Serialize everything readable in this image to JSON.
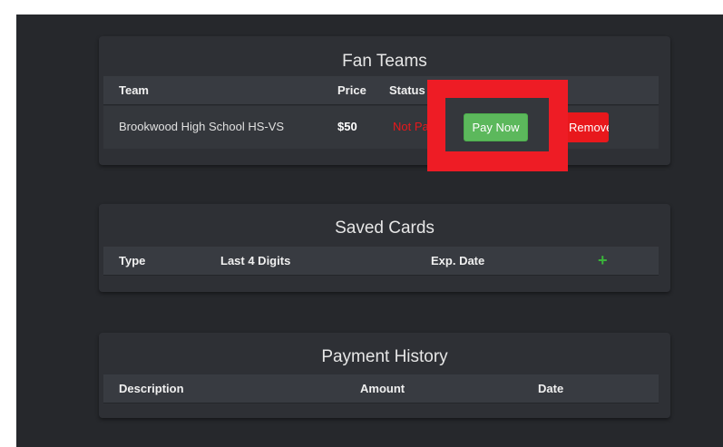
{
  "fan_teams": {
    "title": "Fan Teams",
    "columns": [
      "Team",
      "Price",
      "Status"
    ],
    "row": {
      "team": "Brookwood High School HS-VS",
      "price": "$50",
      "status": "Not Paid",
      "pay_label": "Pay Now",
      "remove_label": "Remove"
    }
  },
  "saved_cards": {
    "title": "Saved Cards",
    "columns": [
      "Type",
      "Last 4 Digits",
      "Exp. Date"
    ],
    "add_icon": "+"
  },
  "payment_history": {
    "title": "Payment History",
    "columns": [
      "Description",
      "Amount",
      "Date"
    ]
  },
  "colors": {
    "background": "#26282c",
    "panel": "#2e3035",
    "status_unpaid": "#e8181c",
    "pay_button": "#5cb85c",
    "highlight": "#ee1c25",
    "add_icon": "#3ab53a"
  }
}
